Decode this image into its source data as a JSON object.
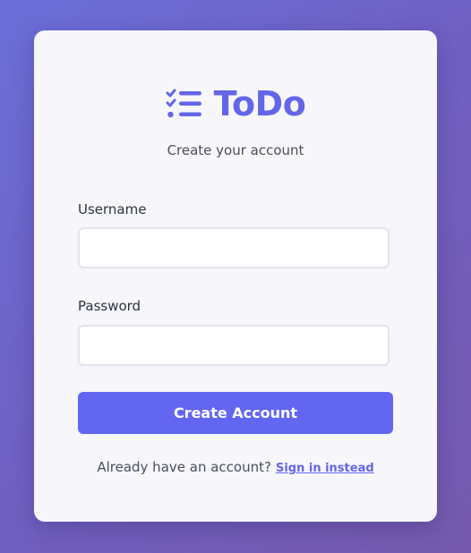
{
  "brand": {
    "name": "ToDo",
    "icon": "checklist-icon",
    "color": "#6366e8"
  },
  "subtitle": "Create your account",
  "form": {
    "username_label": "Username",
    "username_value": "",
    "password_label": "Password",
    "password_value": "",
    "submit_label": "Create Account",
    "submit_color": "#6366f1"
  },
  "footer": {
    "prompt": "Already have an account?",
    "link_label": "Sign in instead"
  }
}
